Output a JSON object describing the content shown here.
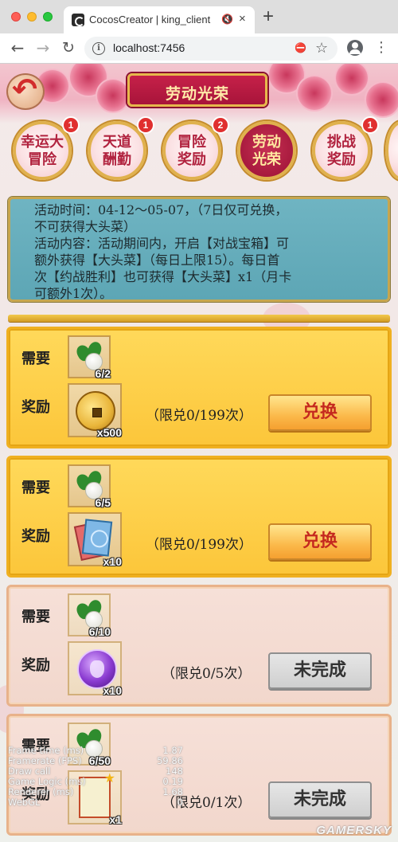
{
  "browser": {
    "tab_title": "CocosCreator | king_client",
    "tab_close": "×",
    "new_tab": "+",
    "url": "localhost:7456",
    "icons": [
      "cocos-favicon",
      "mute-icon",
      "back-arrow-icon",
      "forward-arrow-icon",
      "reload-icon",
      "info-icon",
      "popup-blocked-icon",
      "bookmark-star-icon",
      "profile-icon",
      "menu-dots-icon"
    ]
  },
  "game": {
    "title": "劳动光荣",
    "tabs": [
      {
        "label": "幸运大\n冒险",
        "badge": "1",
        "active": false
      },
      {
        "label": "天道\n酬勤",
        "badge": "1",
        "active": false
      },
      {
        "label": "冒险\n奖励",
        "badge": "2",
        "active": false
      },
      {
        "label": "劳动\n光荣",
        "badge": "",
        "active": true
      },
      {
        "label": "挑战\n奖励",
        "badge": "1",
        "active": false
      }
    ],
    "info": {
      "line1": "活动时间：04-12～05-07，（7日仅可兑换，",
      "line2": "不可获得大头菜）",
      "line3": "活动内容：活动期间内，开启【对战宝箱】可",
      "line4": "额外获得【大头菜】（每日上限15）。每日首",
      "line5": "次【约战胜利】也可获得【大头菜】x1（月卡",
      "line6": "可额外1次）。"
    },
    "need_label": "需要",
    "reward_label": "奖励",
    "cards": [
      {
        "need_count": "6/2",
        "reward_icon": "gold-coin-icon",
        "reward_count": "x500",
        "limit": "（限兑0/199次）",
        "button": "兑换",
        "style": "gold"
      },
      {
        "need_count": "6/5",
        "reward_icon": "card-pack-icon",
        "reward_count": "x10",
        "limit": "（限兑0/199次）",
        "button": "兑换",
        "style": "gold"
      },
      {
        "need_count": "6/10",
        "reward_icon": "purple-orb-icon",
        "reward_count": "x10",
        "limit": "（限兑0/5次）",
        "button": "未完成",
        "style": "pink"
      },
      {
        "need_count": "6/50",
        "reward_icon": "scroll-icon",
        "reward_count": "x1",
        "limit": "（限兑0/1次）",
        "button": "未完成",
        "style": "pink"
      }
    ],
    "stats": [
      {
        "label": "Frame time (ms)",
        "value": "1.87"
      },
      {
        "label": "Framerate (FPS)",
        "value": "59.86"
      },
      {
        "label": "Draw call",
        "value": "148"
      },
      {
        "label": "Game Logic (ms)",
        "value": "0.19"
      },
      {
        "label": "Renderer (ms)",
        "value": "1.68"
      },
      {
        "label": "WebGL",
        "value": "0"
      }
    ],
    "watermark": "GAMERSKY"
  }
}
